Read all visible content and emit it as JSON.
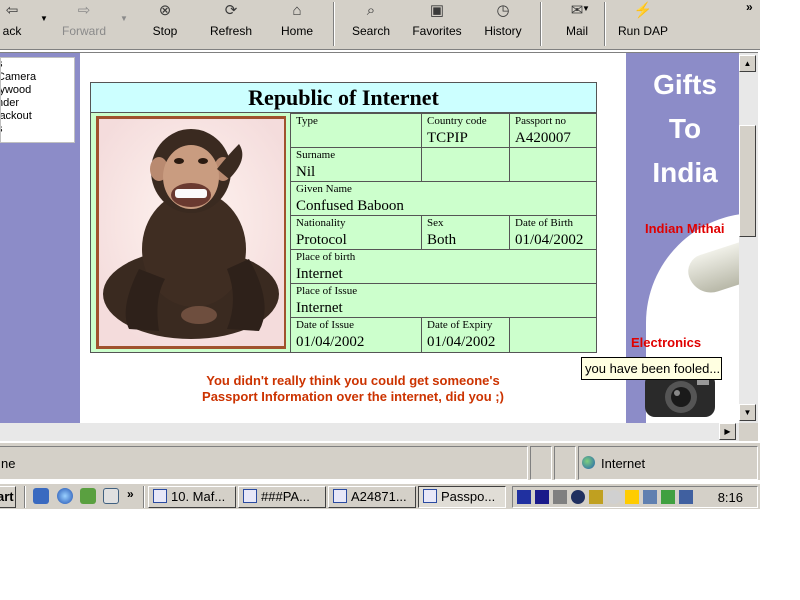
{
  "toolbar": {
    "buttons": [
      {
        "label": "ack",
        "icon": "back-arrow-icon"
      },
      {
        "label": "Forward",
        "icon": "forward-arrow-icon"
      },
      {
        "label": "Stop",
        "icon": "stop-icon"
      },
      {
        "label": "Refresh",
        "icon": "refresh-icon"
      },
      {
        "label": "Home",
        "icon": "home-icon"
      },
      {
        "label": "Search",
        "icon": "search-icon"
      },
      {
        "label": "Favorites",
        "icon": "favorites-icon"
      },
      {
        "label": "History",
        "icon": "history-icon"
      },
      {
        "label": "Mail",
        "icon": "mail-icon"
      },
      {
        "label": "Run DAP",
        "icon": "run-dap-icon"
      }
    ],
    "more": "»"
  },
  "left_menu": {
    "items": [
      "s",
      "Camera",
      "lywood",
      "nder",
      "lackout",
      "s"
    ]
  },
  "passport": {
    "title": "Republic of Internet",
    "type_label": "Type",
    "country_code_label": "Country code",
    "country_code": "TCPIP",
    "passport_no_label": "Passport no",
    "passport_no": "A420007",
    "surname_label": "Surname",
    "surname": "Nil",
    "given_name_label": "Given Name",
    "given_name": "Confused Baboon",
    "nationality_label": "Nationality",
    "nationality": "Protocol",
    "sex_label": "Sex",
    "sex": "Both",
    "dob_label": "Date of Birth",
    "dob": "01/04/2002",
    "place_of_birth_label": "Place of birth",
    "place_of_birth": "Internet",
    "place_of_issue_label": "Place of Issue",
    "place_of_issue": "Internet",
    "date_of_issue_label": "Date of Issue",
    "date_of_issue": "01/04/2002",
    "date_of_expiry_label": "Date of Expiry",
    "date_of_expiry": "01/04/2002"
  },
  "message": {
    "line1": "You didn't really think you could get someone's",
    "line2": "Passport Information over the internet, did you ;)"
  },
  "ad": {
    "title_line1": "Gifts",
    "title_line2": "To",
    "title_line3": "India",
    "mithai": "Indian Mithai",
    "electronics": "Electronics"
  },
  "tooltip": "you have been fooled...",
  "statusbar": {
    "left_text": "ne",
    "zone": "Internet"
  },
  "taskbar": {
    "start": "art",
    "more": "»",
    "tasks": [
      "10. Maf...",
      "###PA...",
      "A24871...",
      "Passpo..."
    ],
    "clock": "8:16"
  },
  "colors": {
    "banner_bg": "#8c8cc8",
    "passport_bg": "#ccffcc",
    "title_bg": "#ccffff",
    "message": "#cc3300",
    "ad_red": "#e00000"
  }
}
